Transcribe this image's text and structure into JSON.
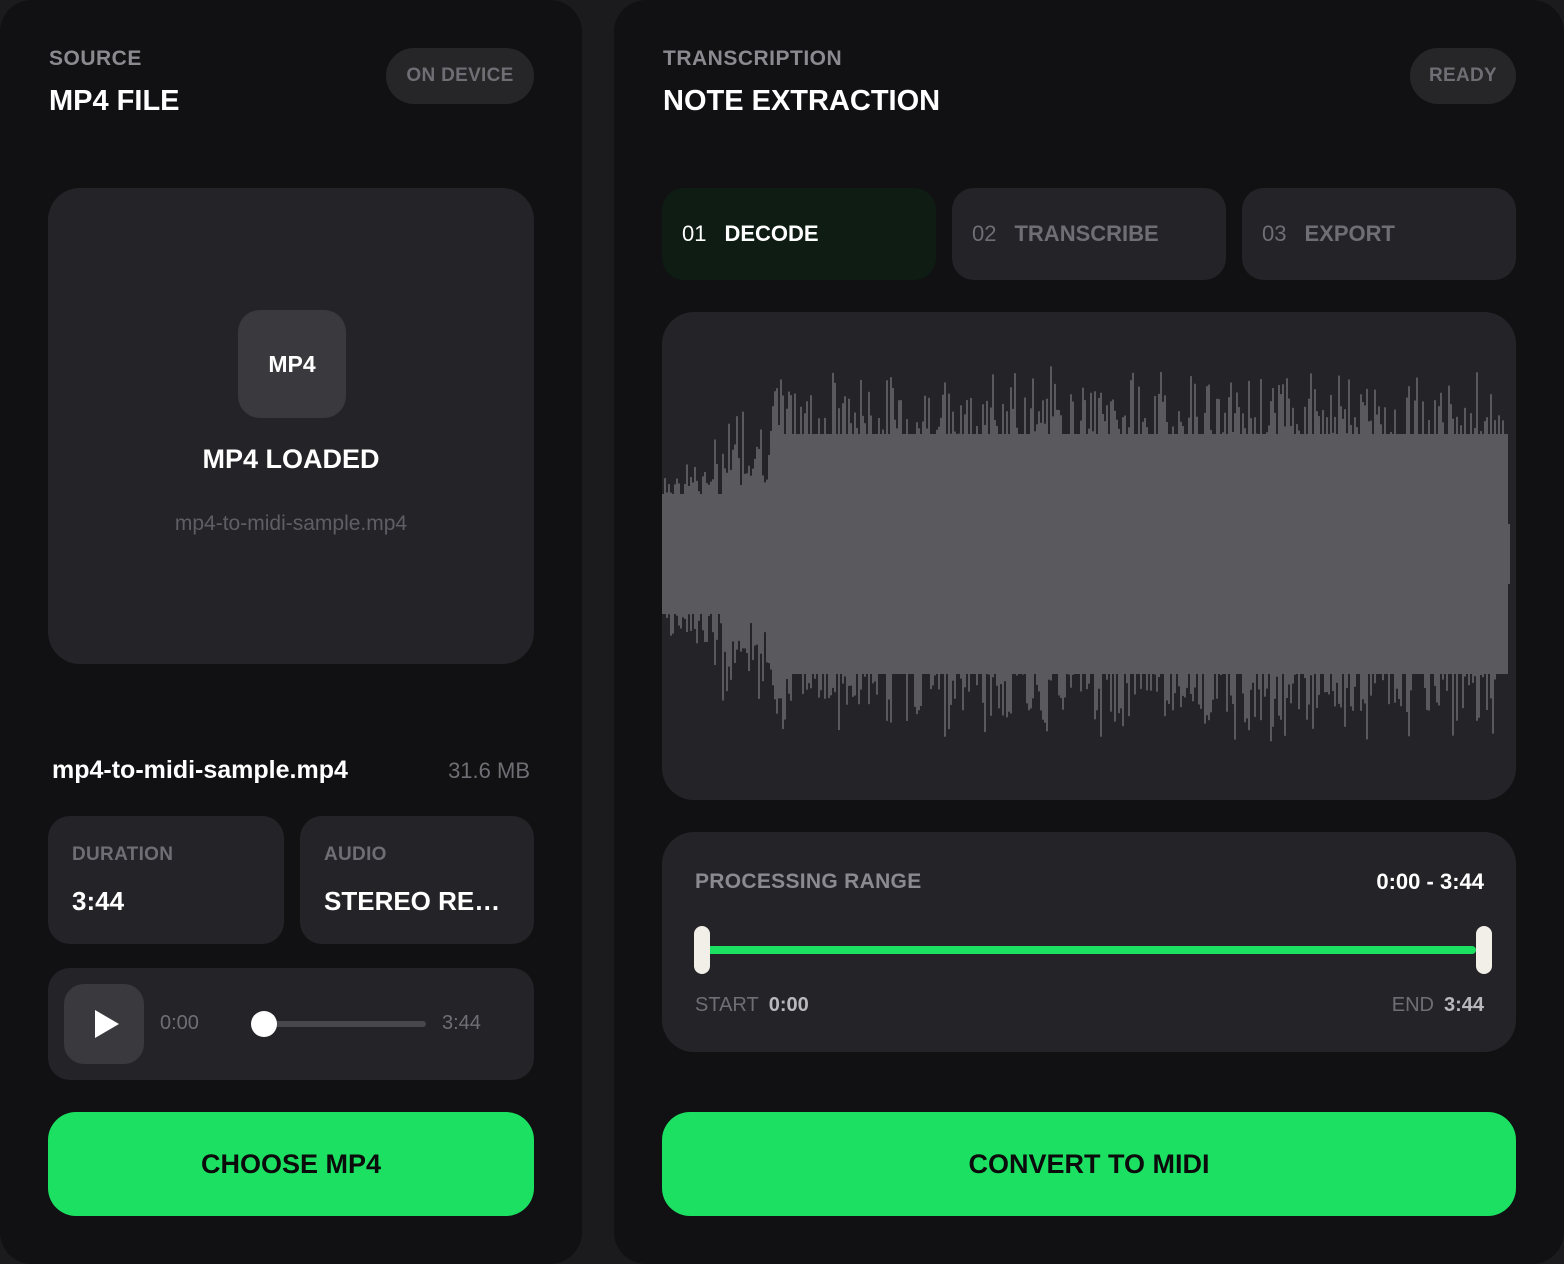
{
  "source": {
    "eyebrow": "SOURCE",
    "title": "MP4 FILE",
    "badge": "ON DEVICE",
    "dropzone": {
      "file_type": "MP4",
      "status": "MP4 LOADED",
      "file_name": "mp4-to-midi-sample.mp4"
    },
    "file": {
      "name": "mp4-to-midi-sample.mp4",
      "size": "31.6 MB"
    },
    "stats": {
      "duration_label": "DURATION",
      "duration_value": "3:44",
      "audio_label": "AUDIO",
      "audio_value": "STEREO REA..."
    },
    "player": {
      "current_time": "0:00",
      "total_time": "3:44",
      "progress": 0
    },
    "choose_button": "CHOOSE MP4"
  },
  "transcription": {
    "eyebrow": "TRANSCRIPTION",
    "title": "NOTE EXTRACTION",
    "badge": "READY",
    "steps": [
      {
        "num": "01",
        "label": "DECODE",
        "active": true
      },
      {
        "num": "02",
        "label": "TRANSCRIBE",
        "active": false
      },
      {
        "num": "03",
        "label": "EXPORT",
        "active": false
      }
    ],
    "range": {
      "label": "PROCESSING RANGE",
      "value": "0:00 - 3:44",
      "start_label": "START",
      "start_value": "0:00",
      "end_label": "END",
      "end_value": "3:44",
      "start_fraction": 0,
      "end_fraction": 1
    },
    "convert_button": "CONVERT TO MIDI"
  },
  "colors": {
    "accent": "#1ce062",
    "panel": "#111113",
    "card": "#242428",
    "waveform": "#5a5a5e"
  },
  "icons": {
    "play": "play-icon"
  }
}
